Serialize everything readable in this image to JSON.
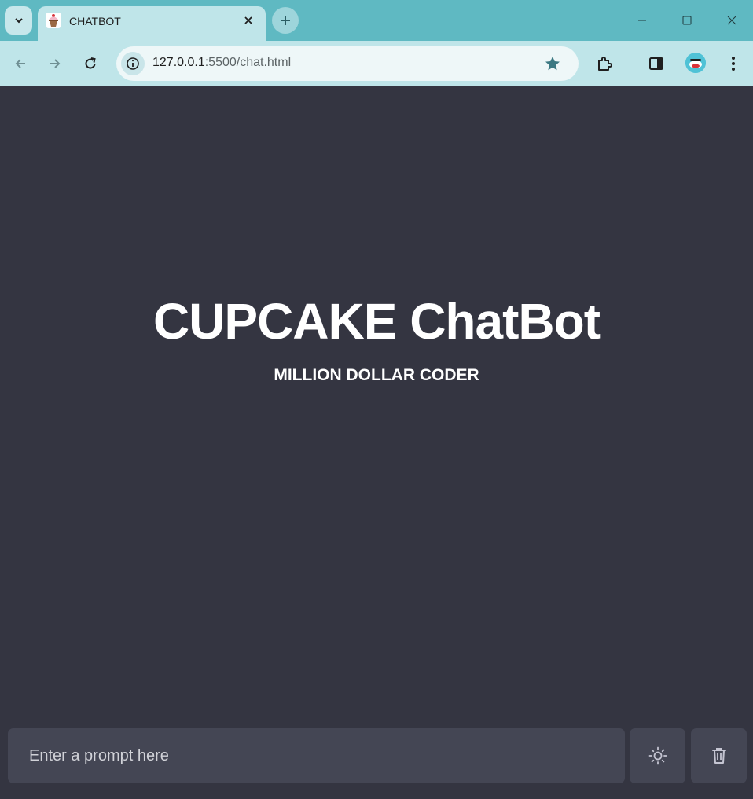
{
  "browser": {
    "tab": {
      "title": "CHATBOT",
      "favicon": "cupcake-icon"
    },
    "url": {
      "host": "127.0.0.1",
      "path": ":5500/chat.html"
    },
    "colors": {
      "tabstrip": "#5fb9c2",
      "toolbar": "#bfe5e9",
      "omnibox": "#eef7f8"
    },
    "icons": [
      "tab-search-icon",
      "close-icon",
      "plus-icon",
      "minimize-icon",
      "maximize-icon",
      "window-close-icon",
      "back-arrow-icon",
      "forward-arrow-icon",
      "reload-icon",
      "info-icon",
      "star-icon",
      "puzzle-icon",
      "side-panel-icon",
      "kebab-menu-icon"
    ]
  },
  "page": {
    "title": "CUPCAKE ChatBot",
    "subtitle": "MILLION DOLLAR CODER",
    "prompt": {
      "placeholder": "Enter a prompt here",
      "value": ""
    },
    "buttons": {
      "theme": "sun-icon",
      "delete": "trash-icon"
    },
    "colors": {
      "background": "#343541",
      "input": "#444654",
      "text": "#ffffff"
    }
  }
}
